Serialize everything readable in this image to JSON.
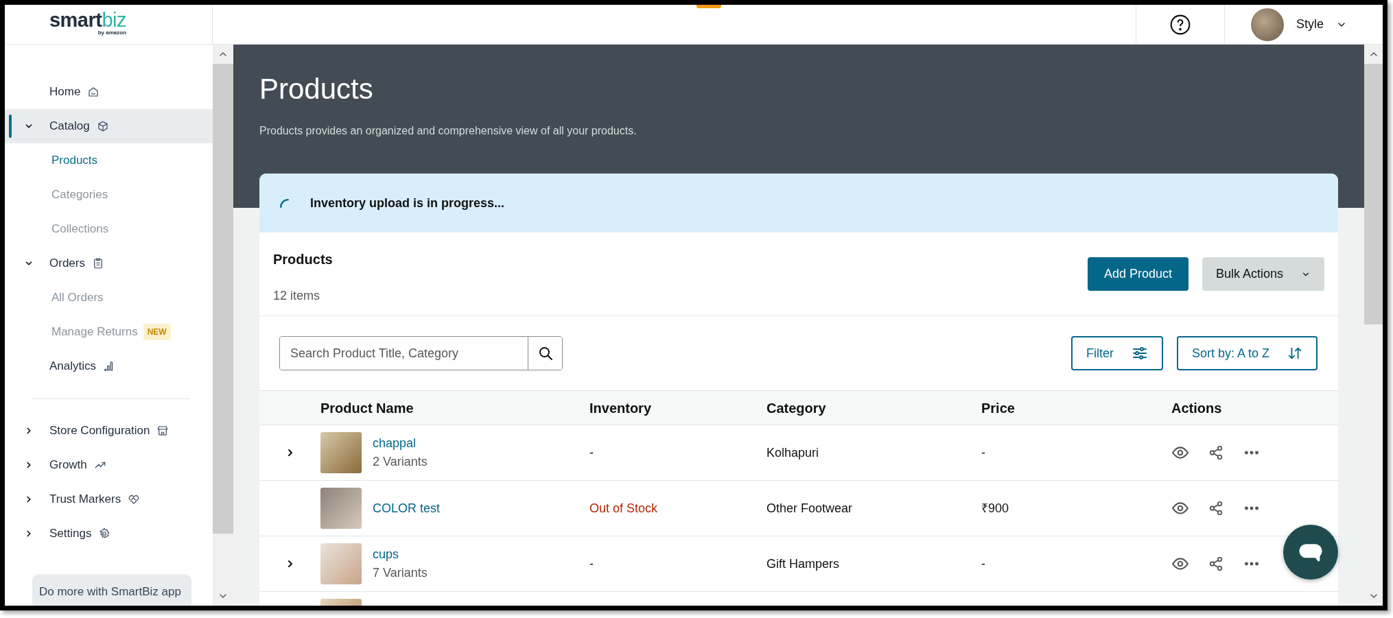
{
  "logo": {
    "primary": "smart",
    "accent": "biz",
    "tagline": "by amazon"
  },
  "header": {
    "user": {
      "name": "Style"
    }
  },
  "sidebar": {
    "items": [
      {
        "label": "Home",
        "kind": "link",
        "selected": false
      },
      {
        "label": "Catalog",
        "kind": "group",
        "expanded": true,
        "selected": true,
        "children": [
          {
            "label": "Products",
            "selected": true
          },
          {
            "label": "Categories",
            "selected": false
          },
          {
            "label": "Collections",
            "selected": false
          }
        ]
      },
      {
        "label": "Orders",
        "kind": "group",
        "expanded": true,
        "selected": false,
        "children": [
          {
            "label": "All Orders",
            "selected": false
          },
          {
            "label": "Manage Returns",
            "selected": false,
            "badge": "NEW"
          }
        ]
      },
      {
        "label": "Analytics",
        "kind": "link",
        "selected": false
      },
      {
        "kind": "divider"
      },
      {
        "label": "Store Configuration",
        "kind": "group",
        "expanded": false,
        "selected": false
      },
      {
        "label": "Growth",
        "kind": "group",
        "expanded": false,
        "selected": false
      },
      {
        "label": "Trust Markers",
        "kind": "group",
        "expanded": false,
        "selected": false
      },
      {
        "label": "Settings",
        "kind": "group",
        "expanded": false,
        "selected": false
      }
    ],
    "promo": "Do more with SmartBiz app"
  },
  "page": {
    "title": "Products",
    "subtitle": "Products provides an organized and comprehensive view of all your products."
  },
  "notice": {
    "text": "Inventory upload is in progress..."
  },
  "card": {
    "title": "Products",
    "count": "12 items",
    "primary_button": "Add Product",
    "secondary_button": "Bulk Actions",
    "search": {
      "placeholder": "Search Product Title, Category"
    },
    "filter": "Filter",
    "sort": "Sort by: A to Z"
  },
  "table": {
    "columns": [
      "Product Name",
      "Inventory",
      "Category",
      "Price",
      "Actions"
    ],
    "rows": [
      {
        "expandable": true,
        "name": "chappal",
        "variants": "2 Variants",
        "inventory": "-",
        "out_of_stock": false,
        "category": "Kolhapuri",
        "price": "-"
      },
      {
        "expandable": false,
        "name": "COLOR test",
        "inventory": "Out of Stock",
        "out_of_stock": true,
        "category": "Other Footwear",
        "price": "₹900"
      },
      {
        "expandable": true,
        "name": "cups",
        "variants": "7 Variants",
        "inventory": "-",
        "out_of_stock": false,
        "category": "Gift Hampers",
        "price": "-"
      }
    ]
  }
}
